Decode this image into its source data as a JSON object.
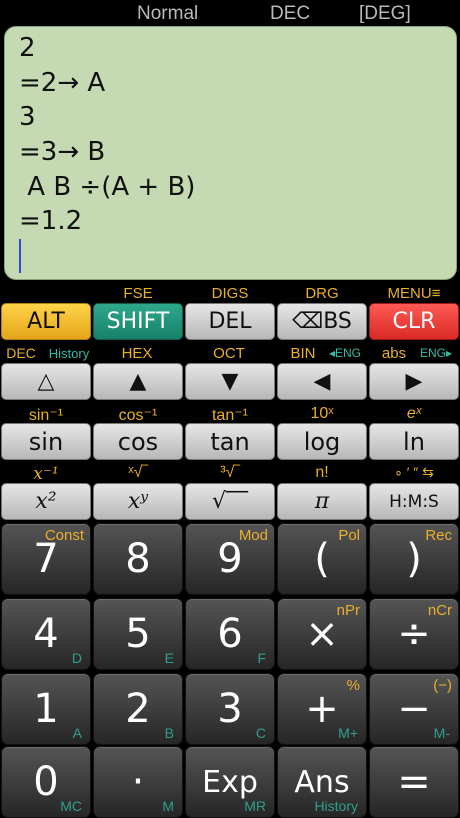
{
  "status": {
    "mode": "Normal",
    "base": "DEC",
    "angle": "[DEG]"
  },
  "display": {
    "lines": [
      "2",
      "=2→ A",
      "3",
      "=3→ B",
      " A B ÷(A + B)",
      "=1.2"
    ]
  },
  "row_top_labels": {
    "fse": "FSE",
    "digs": "DIGS",
    "drg": "DRG",
    "menu": "MENU≡"
  },
  "row_top": {
    "alt": "ALT",
    "shift": "SHIFT",
    "del": "DEL",
    "bs": "⌫BS",
    "clr": "CLR"
  },
  "row_arrow_labels": {
    "dec": "DEC",
    "history": "History",
    "hex": "HEX",
    "oct": "OCT",
    "bin": "BIN",
    "eng1": "◂ENG",
    "abs": "abs",
    "eng2": "ENG▸"
  },
  "row_arrows": {
    "up_outline": "△",
    "up": "▲",
    "down": "▼",
    "left": "◀",
    "right": "▶"
  },
  "row_trig_labels": {
    "asin": "sin⁻¹",
    "acos": "cos⁻¹",
    "atan": "tan⁻¹",
    "tenx": "10ˣ",
    "ex": "eˣ"
  },
  "row_trig": {
    "sin": "sin",
    "cos": "cos",
    "tan": "tan",
    "log": "log",
    "ln": "ln"
  },
  "row_pow_labels": {
    "inv": "x⁻¹",
    "xroot": "ˣ√‾",
    "cuberoot": "³√‾",
    "fact": "n!",
    "dms": "∘ ′ ″ ⇆"
  },
  "row_pow": {
    "square": "x²",
    "power": "xʸ",
    "sqrt": "√‾‾",
    "pi": "π",
    "hms": "H:M:S"
  },
  "keypad": [
    {
      "main": "7",
      "sup": "Const",
      "sub": ""
    },
    {
      "main": "8",
      "sup": "",
      "sub": ""
    },
    {
      "main": "9",
      "sup": "Mod",
      "sub": ""
    },
    {
      "main": "(",
      "sup": "Pol",
      "sub": ""
    },
    {
      "main": ")",
      "sup": "Rec",
      "sub": ""
    },
    {
      "main": "4",
      "sup": "",
      "sub": "D"
    },
    {
      "main": "5",
      "sup": "",
      "sub": "E"
    },
    {
      "main": "6",
      "sup": "",
      "sub": "F"
    },
    {
      "main": "×",
      "sup": "nPr",
      "sub": ""
    },
    {
      "main": "÷",
      "sup": "nCr",
      "sub": ""
    },
    {
      "main": "1",
      "sup": "",
      "sub": "A"
    },
    {
      "main": "2",
      "sup": "",
      "sub": "B"
    },
    {
      "main": "3",
      "sup": "",
      "sub": "C"
    },
    {
      "main": "+",
      "sup": "%",
      "sub": "M+"
    },
    {
      "main": "−",
      "sup": "(−)",
      "sub": "M-"
    },
    {
      "main": "0",
      "sup": "",
      "sub": "MC"
    },
    {
      "main": "·",
      "sup": "",
      "sub": "M"
    },
    {
      "main": "Exp",
      "sup": "",
      "sub": "MR"
    },
    {
      "main": "Ans",
      "sup": "",
      "sub": "History"
    },
    {
      "main": "=",
      "sup": "",
      "sub": ""
    }
  ]
}
